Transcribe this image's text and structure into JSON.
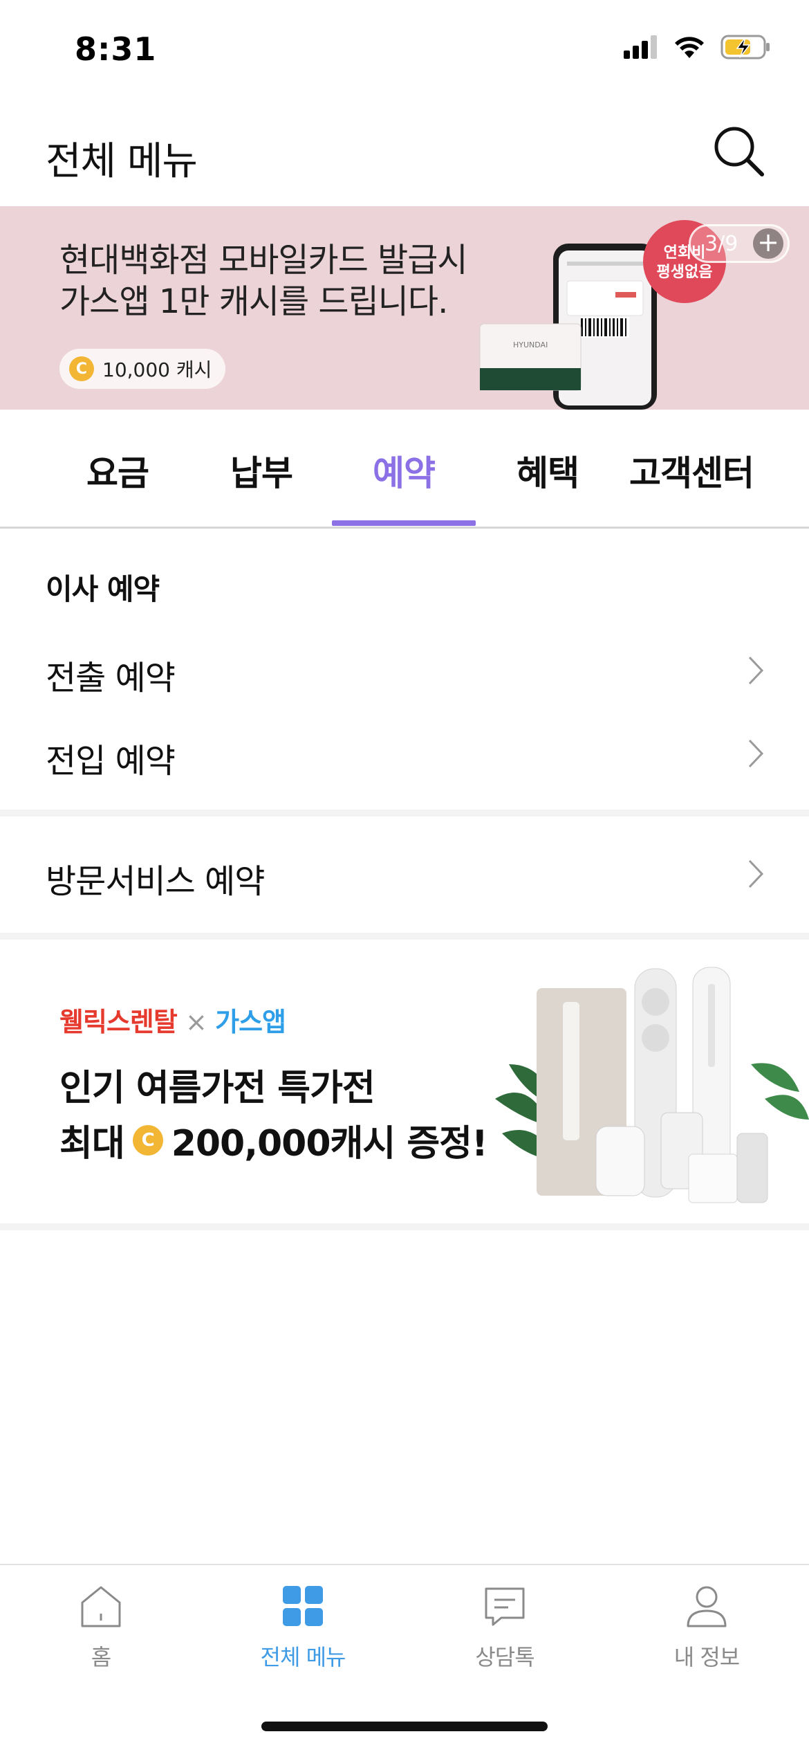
{
  "status_bar": {
    "time": "8:31",
    "icons": [
      "signal-icon",
      "wifi-icon",
      "battery-charging-icon"
    ]
  },
  "header": {
    "title": "전체 메뉴",
    "search_icon": "search-icon"
  },
  "banner": {
    "line1": "현대백화점 모바일카드 발급시",
    "line2": "가스앱 1만 캐시를 드립니다.",
    "cash_label": "10,000 캐시",
    "coin_symbol": "C",
    "badge_line1": "연회비",
    "badge_line2": "평생없음",
    "card_brand": "HYUNDAI",
    "counter": "3/9",
    "plus_label": "+"
  },
  "tabs": [
    {
      "label": "요금",
      "active": false
    },
    {
      "label": "납부",
      "active": false
    },
    {
      "label": "예약",
      "active": true
    },
    {
      "label": "혜택",
      "active": false
    },
    {
      "label": "고객센터",
      "active": false
    }
  ],
  "moving_section": {
    "heading": "이사 예약",
    "items": [
      {
        "label": "전출 예약"
      },
      {
        "label": "전입 예약"
      }
    ]
  },
  "visit_section": {
    "items": [
      {
        "label": "방문서비스 예약"
      }
    ]
  },
  "ad": {
    "brand1": "웰릭스렌탈",
    "separator": "×",
    "brand2": "가스앱",
    "line1": "인기 여름가전 특가전",
    "line2_prefix": "최대",
    "coin_symbol": "C",
    "line2_suffix": "200,000캐시 증정!"
  },
  "bottom_nav": [
    {
      "label": "홈",
      "icon": "home-icon",
      "active": false
    },
    {
      "label": "전체 메뉴",
      "icon": "grid-menu-icon",
      "active": true
    },
    {
      "label": "상담톡",
      "icon": "chat-icon",
      "active": false
    },
    {
      "label": "내 정보",
      "icon": "user-icon",
      "active": false
    }
  ],
  "colors": {
    "accent_purple": "#8b70e6",
    "nav_active_blue": "#3f9be6",
    "banner_bg": "#ecd3d7",
    "coin_gold": "#f2b634"
  }
}
